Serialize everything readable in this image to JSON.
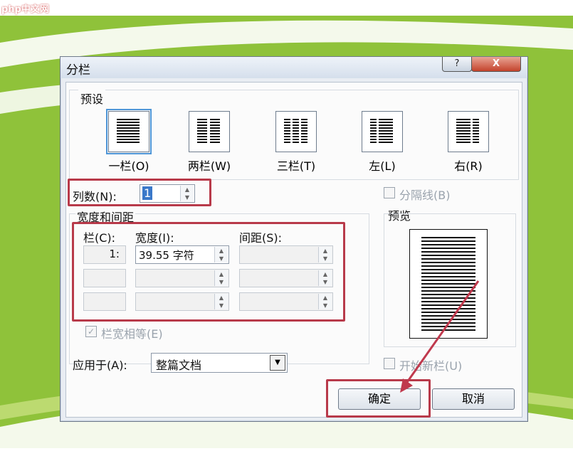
{
  "watermark": "php中文网",
  "window": {
    "title": "分栏",
    "help_label": "?",
    "close_label": "X"
  },
  "presets": {
    "section_label": "预设",
    "items": [
      {
        "label": "一栏(O)"
      },
      {
        "label": "两栏(W)"
      },
      {
        "label": "三栏(T)"
      },
      {
        "label": "左(L)"
      },
      {
        "label": "右(R)"
      }
    ]
  },
  "columns_count": {
    "label": "列数(N):",
    "value": "1"
  },
  "separator": {
    "label": "分隔线(B)",
    "checked": false
  },
  "width_spacing": {
    "section_label": "宽度和间距",
    "col_header": "栏(C):",
    "width_header": "宽度(I):",
    "spacing_header": "间距(S):",
    "rows": [
      {
        "col": "1:",
        "width": "39.55 字符",
        "spacing": ""
      },
      {
        "col": "",
        "width": "",
        "spacing": ""
      },
      {
        "col": "",
        "width": "",
        "spacing": ""
      }
    ]
  },
  "equal_width": {
    "label": "栏宽相等(E)",
    "checked": true
  },
  "preview": {
    "label": "预览"
  },
  "apply_to": {
    "label": "应用于(A):",
    "value": "整篇文档"
  },
  "new_column": {
    "label": "开始新栏(U)",
    "checked": false
  },
  "buttons": {
    "ok": "确定",
    "cancel": "取消"
  },
  "colors": {
    "highlight": "#b83a4a",
    "background": "#8fc23a"
  }
}
